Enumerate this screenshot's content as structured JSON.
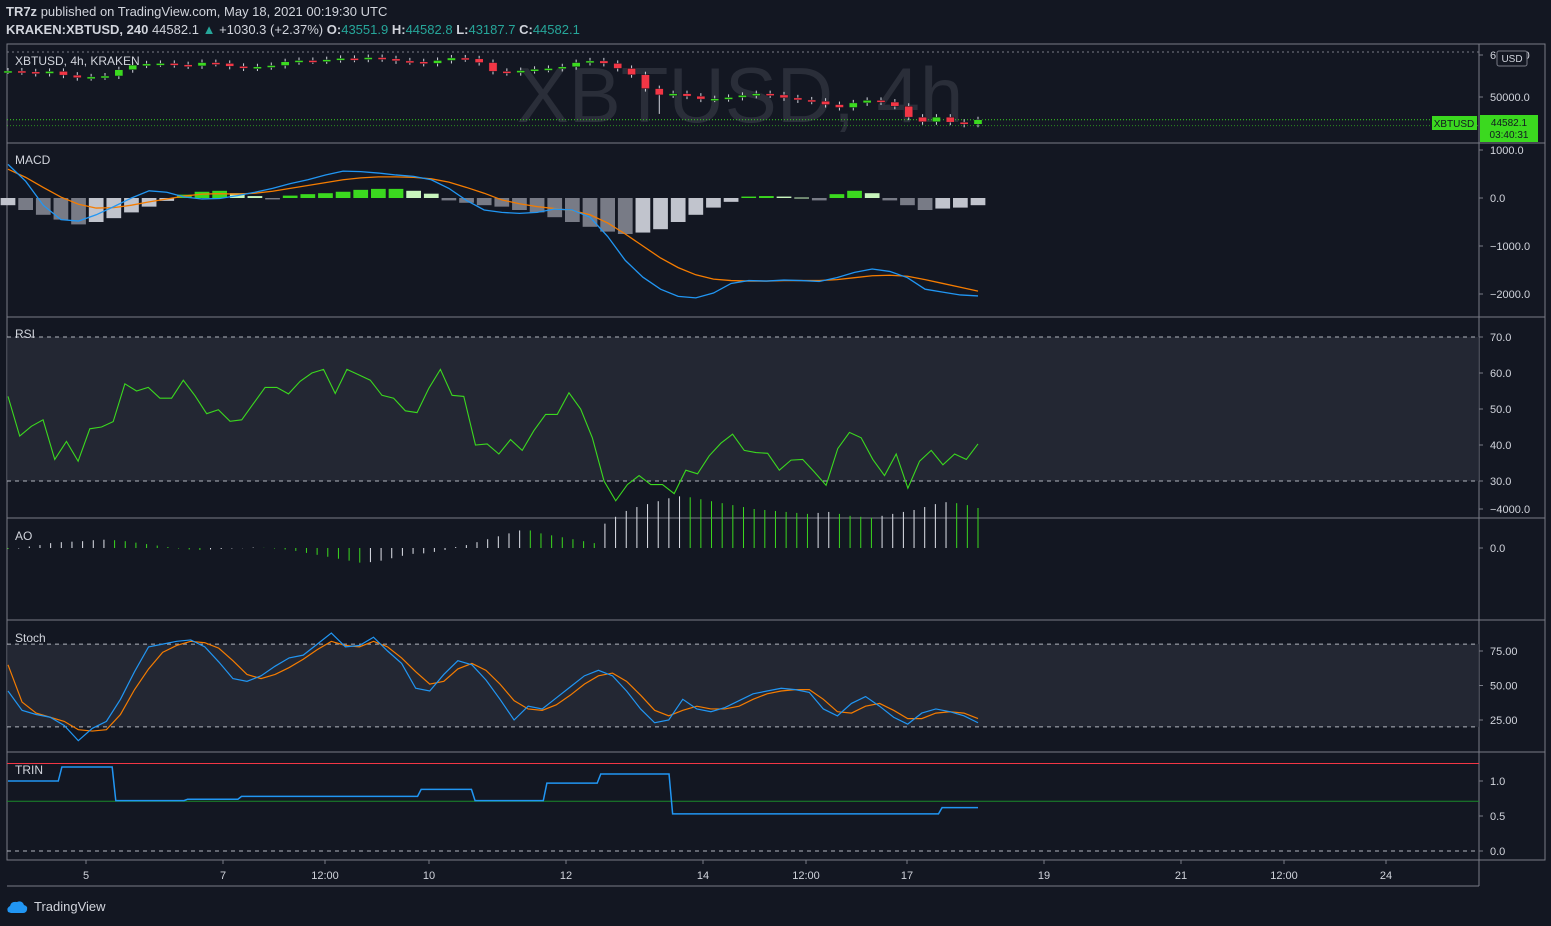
{
  "header": {
    "publisher": "TR7z",
    "published_text": "published on TradingView.com, May 18, 2021 00:19:30 UTC"
  },
  "quote": {
    "symbol": "KRAKEN:XBTUSD, 240",
    "last": "44582.1",
    "change": "+1030.3 (+2.37%)",
    "o_label": "O:",
    "o": "43551.9",
    "h_label": "H:",
    "h": "44582.8",
    "l_label": "L:",
    "l": "43187.7",
    "c_label": "C:",
    "c": "44582.1"
  },
  "watermark": "XBTUSD, 4h",
  "price_pane_label": "XBTUSD, 4h, KRAKEN",
  "currency_badge": "USD",
  "last_price_badge": {
    "symbol": "XBTUSD",
    "price": "44582.1",
    "countdown": "03:40:31"
  },
  "colors": {
    "bg": "#131722",
    "up": "#3bd91f",
    "down": "#f23645",
    "macd": "#2196f3",
    "signal": "#f57c00",
    "rsi": "#3bd91f",
    "stoch_k": "#2196f3",
    "stoch_d": "#f57c00",
    "trin": "#2196f3"
  },
  "panes": {
    "price": {
      "ticks": [
        "60000.0",
        "50000.0"
      ]
    },
    "macd": {
      "label": "MACD",
      "ticks": [
        "1000.0",
        "0.0",
        "−1000.0",
        "−2000.0"
      ]
    },
    "rsi": {
      "label": "RSI",
      "ticks": [
        "70.0",
        "60.0",
        "50.0",
        "40.0",
        "30.0"
      ]
    },
    "ao": {
      "label": "AO",
      "ticks": [
        "0.0",
        "−4000.0"
      ]
    },
    "stoch": {
      "label": "Stoch",
      "ticks": [
        "75.00",
        "50.00",
        "25.00"
      ]
    },
    "trin": {
      "label": "TRIN",
      "ticks": [
        "1.0",
        "0.5",
        "0.0"
      ]
    }
  },
  "x_axis": {
    "labels": [
      "5",
      "7",
      "12:00",
      "10",
      "12",
      "14",
      "12:00",
      "17",
      "19",
      "21",
      "12:00",
      "24"
    ]
  },
  "chart_data": {
    "type": "line",
    "price_candles_close": [
      56200,
      56000,
      55600,
      56100,
      55200,
      54600,
      54800,
      55000,
      56500,
      57600,
      57900,
      58000,
      57700,
      57400,
      58200,
      58000,
      57300,
      56900,
      57200,
      57500,
      58400,
      58700,
      58600,
      58900,
      59200,
      59000,
      59400,
      59100,
      58600,
      58400,
      58000,
      58700,
      59300,
      59100,
      58200,
      56100,
      55800,
      56300,
      56600,
      56800,
      57200,
      58200,
      58600,
      58000,
      56800,
      55300,
      52000,
      50500,
      50800,
      50200,
      49500,
      49600,
      49900,
      50400,
      50800,
      50500,
      49800,
      49300,
      49000,
      48200,
      47500,
      48600,
      49200,
      48800,
      47800,
      45200,
      44100,
      45200,
      44000,
      43500,
      44582
    ],
    "macd": [
      700,
      350,
      -150,
      -450,
      -480,
      -350,
      -180,
      0,
      150,
      120,
      20,
      -20,
      -10,
      50,
      120,
      200,
      300,
      380,
      480,
      560,
      550,
      520,
      480,
      450,
      380,
      200,
      -50,
      -250,
      -300,
      -320,
      -300,
      -230,
      -250,
      -400,
      -800,
      -1300,
      -1650,
      -1900,
      -2050,
      -2080,
      -1980,
      -1780,
      -1720,
      -1730,
      -1710,
      -1720,
      -1740,
      -1660,
      -1550,
      -1480,
      -1530,
      -1660,
      -1900,
      -1960,
      -2020,
      -2040
    ],
    "signal": [
      600,
      430,
      220,
      20,
      -130,
      -210,
      -200,
      -150,
      -80,
      -20,
      40,
      80,
      90,
      80,
      100,
      140,
      200,
      260,
      320,
      380,
      420,
      440,
      440,
      430,
      400,
      330,
      220,
      100,
      -40,
      -120,
      -180,
      -220,
      -260,
      -350,
      -520,
      -750,
      -1000,
      -1250,
      -1450,
      -1600,
      -1690,
      -1720,
      -1730,
      -1730,
      -1720,
      -1720,
      -1720,
      -1700,
      -1660,
      -1620,
      -1610,
      -1630,
      -1700,
      -1780,
      -1860,
      -1940
    ],
    "macd_hist": [
      -150,
      -250,
      -350,
      -450,
      -550,
      -500,
      -420,
      -300,
      -180,
      -60,
      70,
      130,
      150,
      100,
      40,
      -30,
      50,
      80,
      100,
      130,
      170,
      190,
      190,
      150,
      90,
      -50,
      -100,
      -150,
      -180,
      -250,
      -300,
      -400,
      -500,
      -600,
      -700,
      -750,
      -720,
      -650,
      -500,
      -350,
      -200,
      -80,
      30,
      40,
      30,
      10,
      -50,
      80,
      150,
      100,
      -50,
      -150,
      -250,
      -220,
      -200,
      -150
    ],
    "rsi": [
      53.5,
      42.5,
      45.2,
      47,
      36,
      41,
      35.5,
      44.5,
      45,
      46.5,
      57,
      55,
      56,
      53,
      53,
      58,
      53.7,
      48.7,
      49.8,
      46.6,
      47,
      51.5,
      56,
      56,
      54.2,
      57.7,
      60,
      61,
      54.3,
      61,
      59.5,
      58,
      53.8,
      53,
      49.5,
      49,
      55.7,
      61,
      53.8,
      53.5,
      40,
      40.3,
      37.5,
      41.5,
      38.5,
      44,
      48.5,
      48.5,
      54.5,
      50,
      42,
      30,
      24.5,
      29,
      31.5,
      29,
      29,
      26.5,
      33,
      32,
      37,
      40.5,
      43,
      38.5,
      37.9,
      37.7,
      33,
      35.8,
      36,
      32.5,
      28.8,
      39,
      43.5,
      42,
      36,
      31.5,
      37.5,
      28,
      35.5,
      38.5,
      34.5,
      37.5,
      36,
      40.3
    ],
    "ao": [
      100,
      50,
      -150,
      -300,
      -500,
      -600,
      -650,
      -700,
      -800,
      -850,
      -800,
      -700,
      -550,
      -400,
      -250,
      -100,
      50,
      150,
      200,
      150,
      100,
      50,
      20,
      -50,
      -20,
      50,
      150,
      300,
      500,
      700,
      900,
      1100,
      1300,
      1500,
      1450,
      1300,
      1050,
      800,
      600,
      550,
      400,
      200,
      -100,
      -300,
      -600,
      -900,
      -1200,
      -1500,
      -1800,
      -1800,
      -1500,
      -1300,
      -1100,
      -900,
      -700,
      -500,
      -2500,
      -3200,
      -3800,
      -4200,
      -4500,
      -4800,
      -5100,
      -5300,
      -5200,
      -5000,
      -4800,
      -4600,
      -4400,
      -4200,
      -4000,
      -3900,
      -3800,
      -3700,
      -3600,
      -3500,
      -3600,
      -3700,
      -3500,
      -3300,
      -3200,
      -3100,
      -3300,
      -3500,
      -3700,
      -3900,
      -4200,
      -4500,
      -4700,
      -4600,
      -4400,
      -4100
    ],
    "stoch_k": [
      46,
      32,
      29,
      27,
      21,
      10,
      19,
      24,
      40,
      60,
      78,
      80,
      82,
      83,
      78,
      67,
      55,
      53,
      57,
      64,
      70,
      72,
      80,
      88,
      78,
      79,
      85,
      75,
      66,
      48,
      46,
      58,
      68,
      65,
      54,
      40,
      25,
      35,
      33,
      41,
      49,
      57,
      61,
      57,
      46,
      33,
      23,
      25,
      40,
      33,
      31,
      34,
      39,
      44,
      46,
      48,
      47,
      45,
      33,
      28,
      37,
      42,
      35,
      27,
      22,
      30,
      33,
      31,
      28,
      23
    ],
    "stoch_d": [
      65,
      38,
      30,
      27,
      24,
      18,
      17,
      18,
      29,
      47,
      62,
      74,
      79,
      82,
      81,
      77,
      68,
      58,
      55,
      58,
      63,
      69,
      76,
      82,
      79,
      78,
      82,
      78,
      70,
      60,
      51,
      53,
      62,
      66,
      61,
      51,
      39,
      33,
      32,
      36,
      43,
      51,
      57,
      59,
      53,
      43,
      32,
      28,
      32,
      35,
      33,
      33,
      35,
      40,
      44,
      46,
      47,
      47,
      40,
      31,
      30,
      35,
      37,
      32,
      26,
      26,
      30,
      31,
      30,
      26
    ],
    "trin": [
      1.0,
      1.0,
      1.0,
      1.2,
      1.2,
      1.2,
      0.72,
      0.72,
      0.72,
      0.72,
      0.74,
      0.74,
      0.74,
      0.78,
      0.78,
      0.78,
      0.78,
      0.78,
      0.78,
      0.78,
      0.78,
      0.78,
      0.78,
      0.88,
      0.88,
      0.88,
      0.72,
      0.72,
      0.72,
      0.72,
      0.97,
      0.97,
      0.97,
      1.1,
      1.1,
      1.1,
      1.1,
      0.53,
      0.53,
      0.53,
      0.53,
      0.53,
      0.53,
      0.53,
      0.53,
      0.53,
      0.53,
      0.53,
      0.53,
      0.53,
      0.53,
      0.53,
      0.62,
      0.62,
      0.62
    ],
    "rsi_bands": [
      70,
      30
    ],
    "stoch_bands": [
      80,
      20
    ],
    "trin_levels": [
      1.25,
      0.71
    ]
  }
}
